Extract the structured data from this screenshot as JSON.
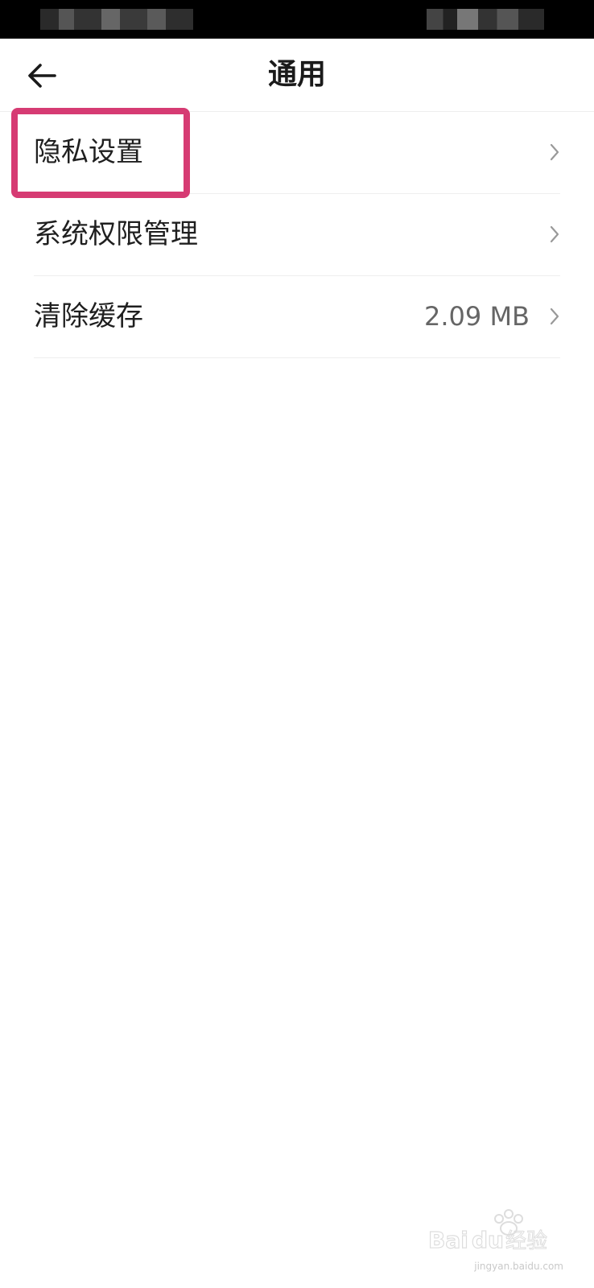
{
  "header": {
    "title": "通用",
    "back_icon": "arrow-left-icon"
  },
  "settings": {
    "items": [
      {
        "label": "隐私设置",
        "value": "",
        "icon": "chevron-right-icon"
      },
      {
        "label": "系统权限管理",
        "value": "",
        "icon": "chevron-right-icon"
      },
      {
        "label": "清除缓存",
        "value": "2.09 MB",
        "icon": "chevron-right-icon"
      }
    ]
  },
  "annotation": {
    "highlight_color": "#d63b73"
  },
  "watermark": {
    "brand": "Baidu经验",
    "url": "jingyan.baidu.com"
  },
  "colors": {
    "status_bar": "#000000",
    "background": "#ffffff",
    "divider": "#eeeeee",
    "text_primary": "#1f1f1f",
    "text_secondary": "#666666"
  }
}
